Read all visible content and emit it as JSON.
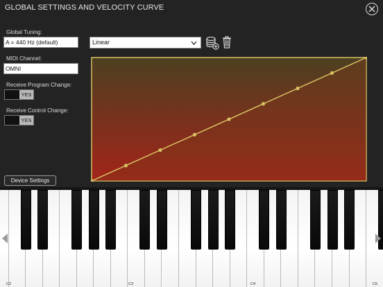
{
  "header": {
    "title": "GLOBAL SETTINGS AND VELOCITY CURVE"
  },
  "settings": {
    "tuning_label": "Global Tuning:",
    "tuning_value": "A = 440 Hz (default)",
    "midi_label": "MIDI Channel:",
    "midi_value": "OMNI",
    "program_label": "Receive Program Change:",
    "program_toggle": "YES",
    "control_label": "Receive Control Change:",
    "control_toggle": "YES"
  },
  "curve": {
    "selected": "Linear",
    "points": 9
  },
  "footer": {
    "device_settings": "Device Settings"
  },
  "keyboard": {
    "notes": [
      "C2",
      "C3",
      "C4",
      "C5"
    ]
  },
  "colors": {
    "curve_line": "#d8c062",
    "curve_top": "#5a4a24",
    "curve_bottom": "#b0251a",
    "toggle_on": "#b8b8b8"
  },
  "icons": {
    "close": "close-icon",
    "dropdown": "chevron-down-icon",
    "save": "database-add-icon",
    "delete": "trash-icon",
    "left": "scroll-left-icon",
    "right": "scroll-right-icon"
  }
}
